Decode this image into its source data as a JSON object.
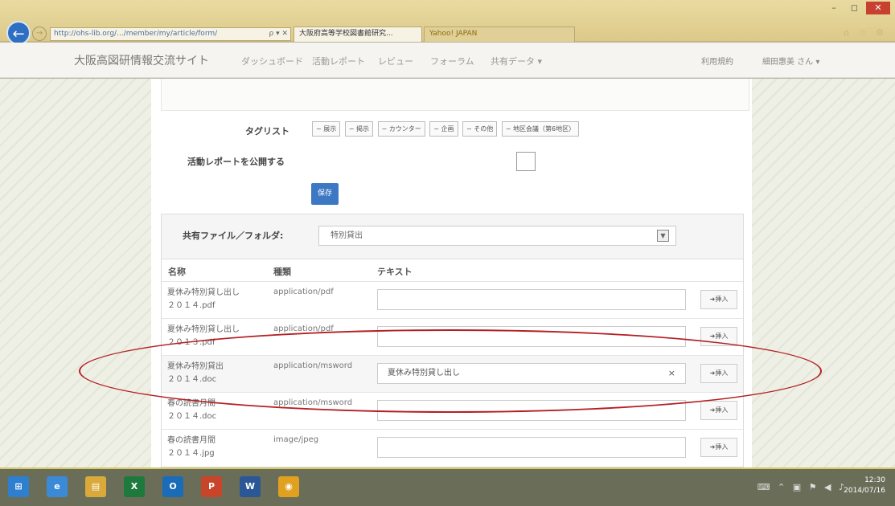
{
  "browser": {
    "url": "http://ohs-lib.org/.../member/my/article/form/",
    "url_tools": "ρ ▾ ✕",
    "tab_active": "大阪府高等学校図書館研究...",
    "tab_inactive": "Yahoo! JAPAN",
    "window_controls": [
      "–",
      "◻",
      "✕"
    ],
    "right_icons": "⌂ ☆ ⚙"
  },
  "nav": {
    "brand": "大阪高図研情報交流サイト",
    "items": [
      "ダッシュボード",
      "活動レポート",
      "レビュー",
      "フォーラム",
      "共有データ ▾"
    ],
    "terms": "利用規約",
    "user": "細田惠美 さん ▾"
  },
  "form": {
    "tag_list_label": "タグリスト",
    "tags": [
      "− 展示",
      "− 掲示",
      "− カウンター",
      "− 企画",
      "− その他",
      "− 地区会議（第6地区）"
    ],
    "publish_label": "活動レポートを公開する",
    "save_label": "保存"
  },
  "files": {
    "folder_label": "共有ファイル／フォルダ:",
    "folder_selected": "特別貸出",
    "headers": {
      "name": "名称",
      "type": "種類",
      "text": "テキスト"
    },
    "rows": [
      {
        "name1": "夏休み特別貸し出し",
        "name2": "２０１４.pdf",
        "type": "application/pdf",
        "text": "",
        "btn": "➜挿入"
      },
      {
        "name1": "夏休み特別貸し出し",
        "name2": "２０１３.pdf",
        "type": "application/pdf",
        "text": "",
        "btn": "➜挿入"
      },
      {
        "name1": "夏休み特別貸出",
        "name2": "２０１４.doc",
        "type": "application/msword",
        "text": "夏休み特別貸し出し",
        "btn": "➜挿入"
      },
      {
        "name1": "春の読書月間",
        "name2": "２０１４.doc",
        "type": "application/msword",
        "text": "",
        "btn": "➜挿入"
      },
      {
        "name1": "春の読書月間",
        "name2": "２０１４.jpg",
        "type": "image/jpeg",
        "text": "",
        "btn": "➜挿入"
      }
    ]
  },
  "taskbar": {
    "apps": [
      "⊞",
      "e",
      "▤",
      "X",
      "O",
      "P",
      "W",
      "◉"
    ],
    "tray": "⌨ ⌃ ▣ ⚑ ◀ ♪",
    "time": "12:30",
    "date": "2014/07/16"
  },
  "colors": {
    "accent": "#3d78c4",
    "annotation": "#b32024",
    "titlebar": "#e3d396"
  }
}
